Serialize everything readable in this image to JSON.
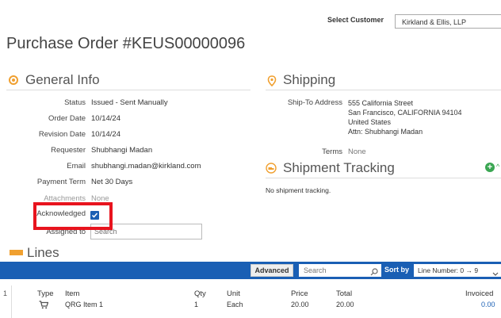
{
  "header": {
    "select_customer_label": "Select Customer",
    "customer_value": "Kirkland & Ellis, LLP",
    "title": "Purchase Order #KEUS00000096"
  },
  "general_info": {
    "heading": "General Info",
    "fields": [
      {
        "label": "Status",
        "value": "Issued - Sent Manually"
      },
      {
        "label": "Order Date",
        "value": "10/14/24"
      },
      {
        "label": "Revision Date",
        "value": "10/14/24"
      },
      {
        "label": "Requester",
        "value": "Shubhangi Madan"
      },
      {
        "label": "Email",
        "value": "shubhangi.madan@kirkland.com"
      },
      {
        "label": "Payment Term",
        "value": "Net 30 Days"
      },
      {
        "label": "Attachments",
        "value": "None"
      }
    ],
    "acknowledged_label": "Acknowledged",
    "assigned_to_label": "Assigned to",
    "assigned_to_placeholder": "Search"
  },
  "shipping": {
    "heading": "Shipping",
    "ship_to_label": "Ship-To Address",
    "address_lines": [
      "555 California Street",
      "San Francisco, CALIFORNIA 94104",
      "United States",
      "Attn: Shubhangi Madan"
    ],
    "terms_label": "Terms",
    "terms_value": "None"
  },
  "shipment_tracking": {
    "heading": "Shipment Tracking",
    "empty_text": "No shipment tracking.",
    "add_icon_glyph": "+",
    "add_suffix": "^"
  },
  "lines": {
    "heading": "Lines",
    "toolbar": {
      "advanced_label": "Advanced",
      "search_placeholder": "Search",
      "sort_by_label": "Sort by",
      "sort_value": "Line Number: 0 → 9"
    },
    "columns": {
      "type": "Type",
      "item": "Item",
      "qty": "Qty",
      "unit": "Unit",
      "price": "Price",
      "total": "Total",
      "invoiced": "Invoiced"
    },
    "rows": [
      {
        "num": "1",
        "item": "QRG Item 1",
        "qty": "1",
        "unit": "Each",
        "price": "20.00",
        "total": "20.00",
        "invoiced": "0.00"
      }
    ]
  },
  "colors": {
    "accent_blue": "#1a5fb4",
    "highlight_red": "#e8141e",
    "orange_icon": "#f0a030",
    "green_add": "#3aa652"
  }
}
